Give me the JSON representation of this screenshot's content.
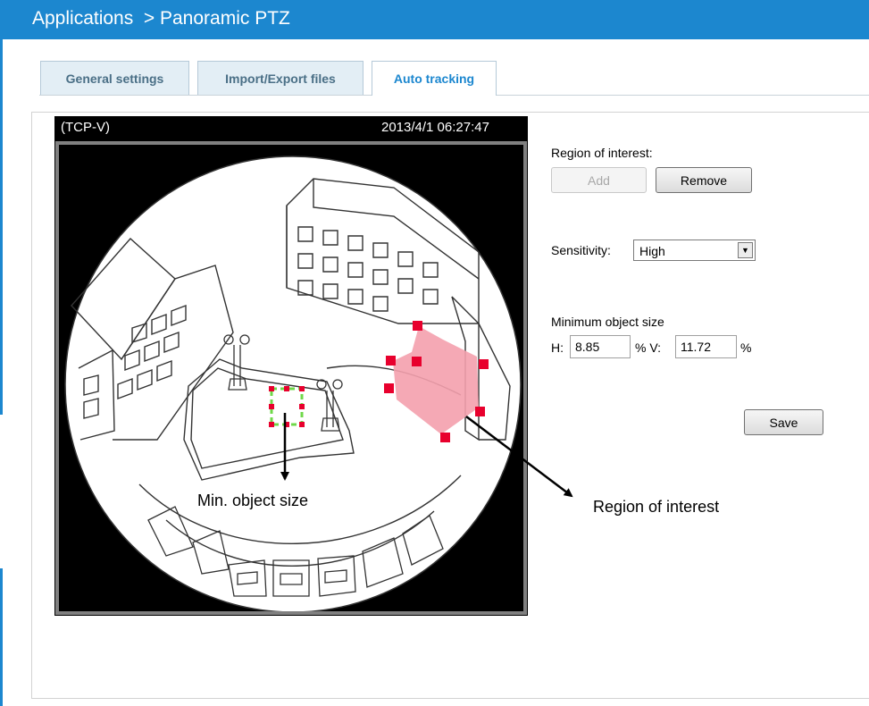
{
  "header": {
    "title": "Applications  > Panoramic PTZ"
  },
  "tabs": [
    {
      "label": "General settings",
      "active": false
    },
    {
      "label": "Import/Export files",
      "active": false
    },
    {
      "label": "Auto tracking",
      "active": true
    }
  ],
  "video": {
    "stream_label": "(TCP-V)",
    "timestamp": "2013/4/1 06:27:47"
  },
  "annotations": {
    "min_object_size": "Min. object size",
    "region_of_interest": "Region of interest"
  },
  "roi": {
    "label": "Region of interest:",
    "add_label": "Add",
    "remove_label": "Remove"
  },
  "sensitivity": {
    "label": "Sensitivity:",
    "value": "High"
  },
  "min_size": {
    "label": "Minimum object size",
    "h_label": "H:",
    "h_value": "8.85",
    "v_label": "% V:",
    "v_value": "11.72",
    "unit": "%"
  },
  "save_label": "Save",
  "colors": {
    "header": "#1c87cf",
    "roi_fill": "#f4a0ad",
    "roi_handle": "#e8002d",
    "min_box": "#6fd84a"
  }
}
